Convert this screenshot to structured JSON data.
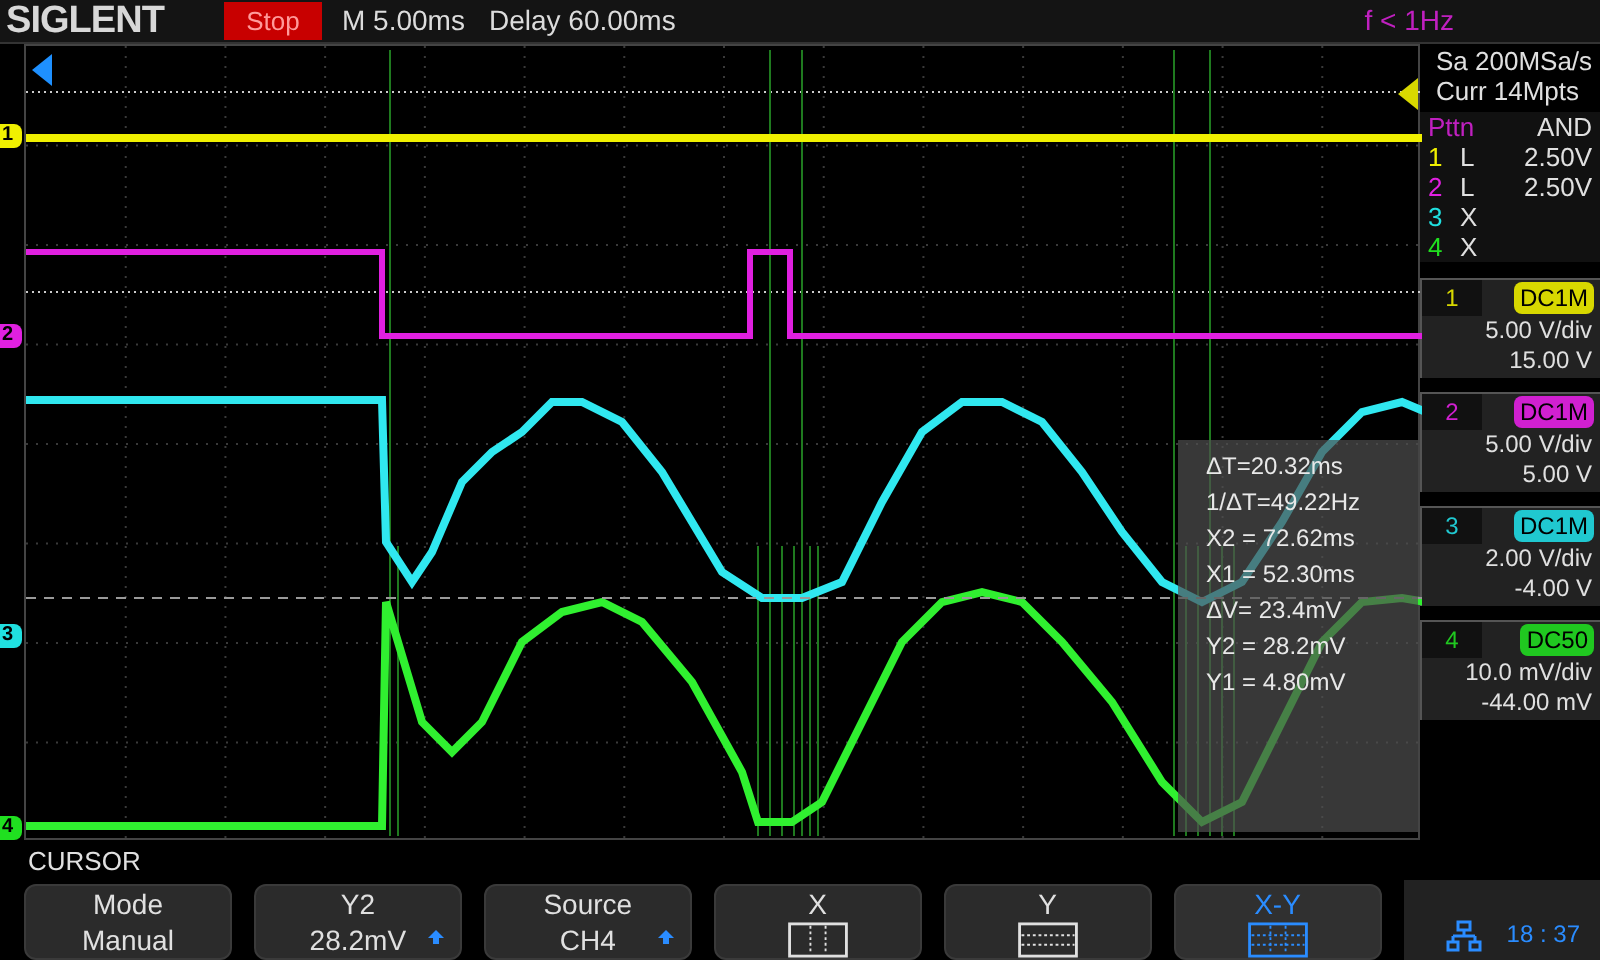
{
  "header": {
    "brand": "SIGLENT",
    "run_state": "Stop",
    "timebase": "M 5.00ms",
    "delay": "Delay 60.00ms",
    "trigger_freq": "f < 1Hz"
  },
  "acquisition": {
    "sample_rate": "Sa 200MSa/s",
    "memory": "Curr 14Mpts"
  },
  "trigger_pattern": {
    "title": "Pttn",
    "logic": "AND",
    "rows": [
      {
        "channel": "1",
        "state": "L",
        "level": "2.50V",
        "color": "#f0f000"
      },
      {
        "channel": "2",
        "state": "L",
        "level": "2.50V",
        "color": "#e020e0"
      },
      {
        "channel": "3",
        "state": "X",
        "color": "#20e0e0"
      },
      {
        "channel": "4",
        "state": "X",
        "color": "#20e020"
      }
    ]
  },
  "channels": [
    {
      "number": "1",
      "coupling": "DC1M",
      "scale": "5.00 V/div",
      "offset": "15.00 V",
      "color": "#d8d800"
    },
    {
      "number": "2",
      "coupling": "DC1M",
      "scale": "5.00 V/div",
      "offset": "5.00 V",
      "color": "#d020d0"
    },
    {
      "number": "3",
      "coupling": "DC1M",
      "scale": "2.00 V/div",
      "offset": "-4.00 V",
      "color": "#20c8d0"
    },
    {
      "number": "4",
      "coupling": "DC50",
      "scale": "10.0 mV/div",
      "offset": "-44.00 mV",
      "color": "#20c820"
    }
  ],
  "trace_markers": [
    {
      "label": "1",
      "color": "#f0f000"
    },
    {
      "label": "2",
      "color": "#e020e0"
    },
    {
      "label": "3",
      "color": "#20e0e0"
    },
    {
      "label": "4",
      "color": "#20e020"
    }
  ],
  "cursor_readout": [
    "ΔT=20.32ms",
    "1/ΔT=49.22Hz",
    "X2 = 72.62ms",
    "X1 = 52.30ms",
    "ΔV= 23.4mV",
    "Y2 = 28.2mV",
    "Y1 = 4.80mV"
  ],
  "menu": {
    "title": "CURSOR",
    "buttons": [
      {
        "kind": "text",
        "lines": [
          "Mode",
          "Manual"
        ],
        "selected": false
      },
      {
        "kind": "value",
        "lines": [
          "Y2",
          "28.2mV"
        ],
        "selected": false
      },
      {
        "kind": "value",
        "lines": [
          "Source",
          "CH4"
        ],
        "selected": false
      },
      {
        "kind": "x-lines",
        "lines": [
          "X"
        ],
        "selected": false
      },
      {
        "kind": "y-lines",
        "lines": [
          "Y"
        ],
        "selected": false
      },
      {
        "kind": "xy-lines",
        "lines": [
          "X-Y"
        ],
        "selected": true
      }
    ]
  },
  "status": {
    "time": "18 : 37"
  }
}
